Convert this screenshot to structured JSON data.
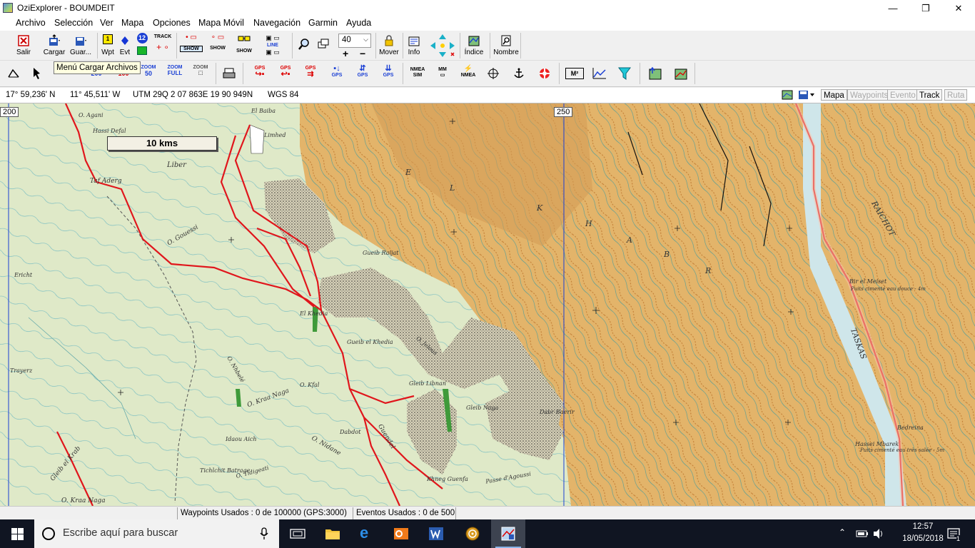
{
  "window": {
    "title": "OziExplorer - BOUMDEIT",
    "minimize": "—",
    "maximize": "❐",
    "close": "✕"
  },
  "menu": [
    "Archivo",
    "Selección",
    "Ver",
    "Mapa",
    "Opciones",
    "Mapa Móvil",
    "Navegación",
    "Garmin",
    "Ayuda"
  ],
  "toolbar1": {
    "salir": "Salir",
    "cargar": "Cargar",
    "guardar": "Guar...",
    "wpt": "Wpt",
    "evt": "Evt",
    "wpt_number": "1",
    "count_badge": "12",
    "track": "TRACK",
    "show": "SHOW",
    "line": "LINE",
    "zoom_value": "40",
    "mover": "Mover",
    "info": "Info",
    "indice": "Índice",
    "nombre": "Nombre"
  },
  "toolbar2": {
    "zoom200": "200",
    "zoom100": "100",
    "zoom50": "50",
    "zoomfull": "FULL",
    "zoom": "ZOOM",
    "gps": "GPS",
    "nmea": "NMEA",
    "sim": "SIM",
    "mm": "MM",
    "m2": "M²"
  },
  "tooltip": "Menú Cargar Archivos",
  "coordbar": {
    "lat": "17° 59,236' N",
    "lon": "11° 45,511' W",
    "utm": "UTM  29Q   2 07 863E   19 90 949N",
    "datum": "WGS 84",
    "tabs": [
      "Mapa",
      "Waypoints",
      "Evento",
      "Track",
      "Ruta"
    ],
    "disabled_tabs": [
      "Waypoints",
      "Evento",
      "Ruta"
    ]
  },
  "map": {
    "scale_label": "10 kms",
    "grid_labels": [
      "200",
      "250"
    ],
    "place_names": [
      "O. Agani",
      "Hassi Defal",
      "El Baiba",
      "Limhed",
      "Liber",
      "Taf Aderg",
      "O. Gouessi",
      "Gueib Raijat",
      "Ericht",
      "El Khedia",
      "Gueib el Khedia",
      "O. Jelous",
      "Gleib Libnan",
      "Gleib Naga",
      "Dabr Buerir",
      "O. Nhbelé",
      "O. Kfal",
      "O. Kraa Naga",
      "Trayerz",
      "Idaou Aich",
      "Dabdot",
      "O. Nidane",
      "Guendel",
      "Tichlchit Batrage",
      "O. Tidigeati",
      "Gleib el Krab",
      "O. Kraa Naga",
      "Khneg Guenfa",
      "Passe d'Agoussi",
      "Bir el Meiset",
      "Puits cimenté eau douce - 4m",
      "Bedreina",
      "Hassei Mbarek",
      "Puits cimenté eau très salée - 5m",
      "E",
      "L",
      "K",
      "H",
      "A",
      "B",
      "R",
      "RAICHOT",
      "TASKAS"
    ]
  },
  "statusbar": {
    "waypoints": "Waypoints Usados : 0 de 100000  (GPS:3000)",
    "eventos": "Eventos Usados : 0 de 500"
  },
  "taskbar": {
    "search_placeholder": "Escribe aquí para buscar",
    "time": "12:57",
    "date": "18/05/2018",
    "notification_count": "1"
  },
  "colors": {
    "route_red": "#e0161c",
    "map_green": "#dfe9c8",
    "map_sand": "#e3b46a",
    "taskbar": "#101522"
  }
}
